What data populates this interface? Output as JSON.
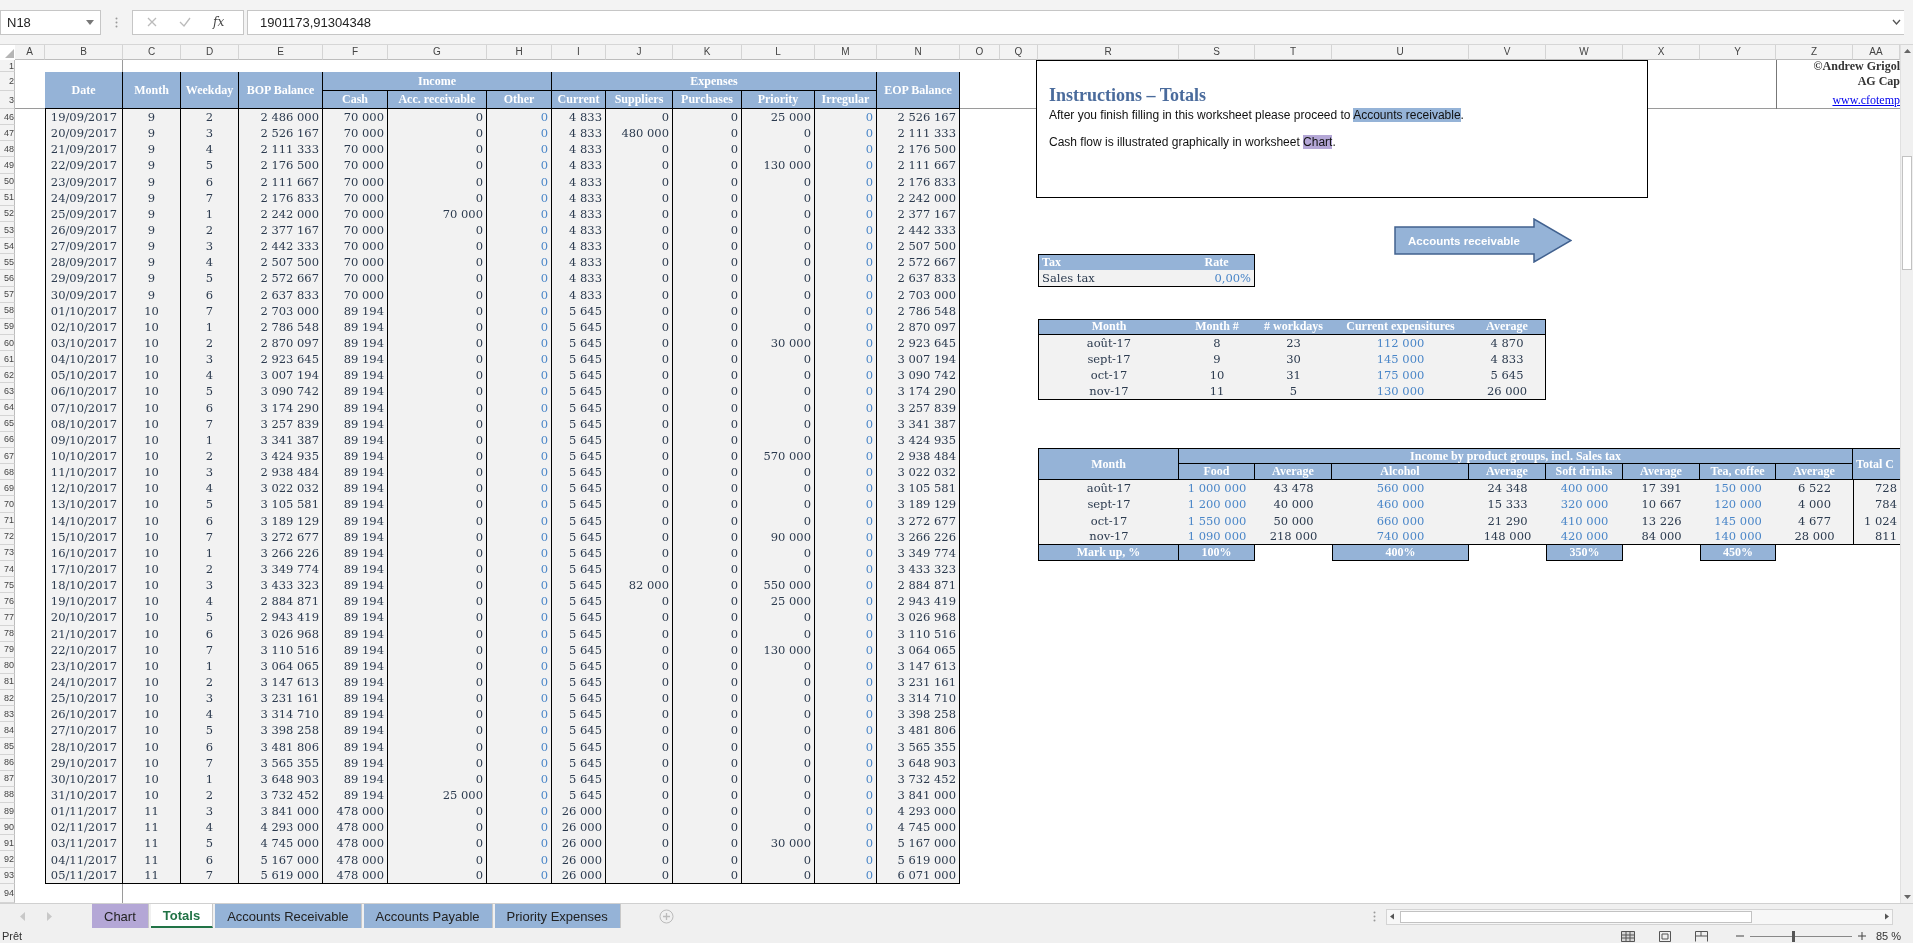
{
  "formula_bar": {
    "name_box": "N18",
    "function_label": "fx",
    "value": "1901173,91304348"
  },
  "column_letters": [
    "A",
    "B",
    "C",
    "D",
    "E",
    "F",
    "G",
    "H",
    "I",
    "J",
    "K",
    "L",
    "M",
    "N",
    "O",
    "Q",
    "R",
    "S",
    "T",
    "U",
    "V",
    "W",
    "X",
    "Y",
    "Z",
    "AA"
  ],
  "row_numbers": [
    "1",
    "2",
    "3",
    "46",
    "47",
    "48",
    "49",
    "50",
    "51",
    "52",
    "53",
    "54",
    "55",
    "56",
    "57",
    "58",
    "59",
    "60",
    "61",
    "62",
    "63",
    "64",
    "65",
    "66",
    "67",
    "68",
    "69",
    "70",
    "71",
    "72",
    "73",
    "74",
    "75",
    "76",
    "77",
    "78",
    "79",
    "80",
    "81",
    "82",
    "83",
    "84",
    "85",
    "86",
    "87",
    "88",
    "89",
    "90",
    "91",
    "92",
    "93",
    "94"
  ],
  "main_table": {
    "header": [
      {
        "label": "Date",
        "input": false
      },
      {
        "label": "Month",
        "input": false
      },
      {
        "label": "Weekday",
        "input": false
      },
      {
        "label": "BOP Balance",
        "input": false
      },
      {
        "label": "Income",
        "sub": [
          {
            "label": "Cash",
            "input": false
          },
          {
            "label": "Acc. receivable",
            "input": false
          },
          {
            "label": "Other",
            "input": true
          }
        ]
      },
      {
        "label": "Expenses",
        "sub": [
          {
            "label": "Current",
            "input": false
          },
          {
            "label": "Suppliers",
            "input": false
          },
          {
            "label": "Purchases",
            "input": false
          },
          {
            "label": "Priority",
            "input": false
          },
          {
            "label": "Irregular",
            "input": true
          }
        ]
      },
      {
        "label": "EOP Balance",
        "input": false
      }
    ],
    "rows": [
      [
        "19/09/2017",
        "9",
        "2",
        "2 486 000",
        "70 000",
        "0",
        "0",
        "4 833",
        "0",
        "0",
        "25 000",
        "0",
        "2 526 167"
      ],
      [
        "20/09/2017",
        "9",
        "3",
        "2 526 167",
        "70 000",
        "0",
        "0",
        "4 833",
        "480 000",
        "0",
        "0",
        "0",
        "2 111 333"
      ],
      [
        "21/09/2017",
        "9",
        "4",
        "2 111 333",
        "70 000",
        "0",
        "0",
        "4 833",
        "0",
        "0",
        "0",
        "0",
        "2 176 500"
      ],
      [
        "22/09/2017",
        "9",
        "5",
        "2 176 500",
        "70 000",
        "0",
        "0",
        "4 833",
        "0",
        "0",
        "130 000",
        "0",
        "2 111 667"
      ],
      [
        "23/09/2017",
        "9",
        "6",
        "2 111 667",
        "70 000",
        "0",
        "0",
        "4 833",
        "0",
        "0",
        "0",
        "0",
        "2 176 833"
      ],
      [
        "24/09/2017",
        "9",
        "7",
        "2 176 833",
        "70 000",
        "0",
        "0",
        "4 833",
        "0",
        "0",
        "0",
        "0",
        "2 242 000"
      ],
      [
        "25/09/2017",
        "9",
        "1",
        "2 242 000",
        "70 000",
        "70 000",
        "0",
        "4 833",
        "0",
        "0",
        "0",
        "0",
        "2 377 167"
      ],
      [
        "26/09/2017",
        "9",
        "2",
        "2 377 167",
        "70 000",
        "0",
        "0",
        "4 833",
        "0",
        "0",
        "0",
        "0",
        "2 442 333"
      ],
      [
        "27/09/2017",
        "9",
        "3",
        "2 442 333",
        "70 000",
        "0",
        "0",
        "4 833",
        "0",
        "0",
        "0",
        "0",
        "2 507 500"
      ],
      [
        "28/09/2017",
        "9",
        "4",
        "2 507 500",
        "70 000",
        "0",
        "0",
        "4 833",
        "0",
        "0",
        "0",
        "0",
        "2 572 667"
      ],
      [
        "29/09/2017",
        "9",
        "5",
        "2 572 667",
        "70 000",
        "0",
        "0",
        "4 833",
        "0",
        "0",
        "0",
        "0",
        "2 637 833"
      ],
      [
        "30/09/2017",
        "9",
        "6",
        "2 637 833",
        "70 000",
        "0",
        "0",
        "4 833",
        "0",
        "0",
        "0",
        "0",
        "2 703 000"
      ],
      [
        "01/10/2017",
        "10",
        "7",
        "2 703 000",
        "89 194",
        "0",
        "0",
        "5 645",
        "0",
        "0",
        "0",
        "0",
        "2 786 548"
      ],
      [
        "02/10/2017",
        "10",
        "1",
        "2 786 548",
        "89 194",
        "0",
        "0",
        "5 645",
        "0",
        "0",
        "0",
        "0",
        "2 870 097"
      ],
      [
        "03/10/2017",
        "10",
        "2",
        "2 870 097",
        "89 194",
        "0",
        "0",
        "5 645",
        "0",
        "0",
        "30 000",
        "0",
        "2 923 645"
      ],
      [
        "04/10/2017",
        "10",
        "3",
        "2 923 645",
        "89 194",
        "0",
        "0",
        "5 645",
        "0",
        "0",
        "0",
        "0",
        "3 007 194"
      ],
      [
        "05/10/2017",
        "10",
        "4",
        "3 007 194",
        "89 194",
        "0",
        "0",
        "5 645",
        "0",
        "0",
        "0",
        "0",
        "3 090 742"
      ],
      [
        "06/10/2017",
        "10",
        "5",
        "3 090 742",
        "89 194",
        "0",
        "0",
        "5 645",
        "0",
        "0",
        "0",
        "0",
        "3 174 290"
      ],
      [
        "07/10/2017",
        "10",
        "6",
        "3 174 290",
        "89 194",
        "0",
        "0",
        "5 645",
        "0",
        "0",
        "0",
        "0",
        "3 257 839"
      ],
      [
        "08/10/2017",
        "10",
        "7",
        "3 257 839",
        "89 194",
        "0",
        "0",
        "5 645",
        "0",
        "0",
        "0",
        "0",
        "3 341 387"
      ],
      [
        "09/10/2017",
        "10",
        "1",
        "3 341 387",
        "89 194",
        "0",
        "0",
        "5 645",
        "0",
        "0",
        "0",
        "0",
        "3 424 935"
      ],
      [
        "10/10/2017",
        "10",
        "2",
        "3 424 935",
        "89 194",
        "0",
        "0",
        "5 645",
        "0",
        "0",
        "570 000",
        "0",
        "2 938 484"
      ],
      [
        "11/10/2017",
        "10",
        "3",
        "2 938 484",
        "89 194",
        "0",
        "0",
        "5 645",
        "0",
        "0",
        "0",
        "0",
        "3 022 032"
      ],
      [
        "12/10/2017",
        "10",
        "4",
        "3 022 032",
        "89 194",
        "0",
        "0",
        "5 645",
        "0",
        "0",
        "0",
        "0",
        "3 105 581"
      ],
      [
        "13/10/2017",
        "10",
        "5",
        "3 105 581",
        "89 194",
        "0",
        "0",
        "5 645",
        "0",
        "0",
        "0",
        "0",
        "3 189 129"
      ],
      [
        "14/10/2017",
        "10",
        "6",
        "3 189 129",
        "89 194",
        "0",
        "0",
        "5 645",
        "0",
        "0",
        "0",
        "0",
        "3 272 677"
      ],
      [
        "15/10/2017",
        "10",
        "7",
        "3 272 677",
        "89 194",
        "0",
        "0",
        "5 645",
        "0",
        "0",
        "90 000",
        "0",
        "3 266 226"
      ],
      [
        "16/10/2017",
        "10",
        "1",
        "3 266 226",
        "89 194",
        "0",
        "0",
        "5 645",
        "0",
        "0",
        "0",
        "0",
        "3 349 774"
      ],
      [
        "17/10/2017",
        "10",
        "2",
        "3 349 774",
        "89 194",
        "0",
        "0",
        "5 645",
        "0",
        "0",
        "0",
        "0",
        "3 433 323"
      ],
      [
        "18/10/2017",
        "10",
        "3",
        "3 433 323",
        "89 194",
        "0",
        "0",
        "5 645",
        "82 000",
        "0",
        "550 000",
        "0",
        "2 884 871"
      ],
      [
        "19/10/2017",
        "10",
        "4",
        "2 884 871",
        "89 194",
        "0",
        "0",
        "5 645",
        "0",
        "0",
        "25 000",
        "0",
        "2 943 419"
      ],
      [
        "20/10/2017",
        "10",
        "5",
        "2 943 419",
        "89 194",
        "0",
        "0",
        "5 645",
        "0",
        "0",
        "0",
        "0",
        "3 026 968"
      ],
      [
        "21/10/2017",
        "10",
        "6",
        "3 026 968",
        "89 194",
        "0",
        "0",
        "5 645",
        "0",
        "0",
        "0",
        "0",
        "3 110 516"
      ],
      [
        "22/10/2017",
        "10",
        "7",
        "3 110 516",
        "89 194",
        "0",
        "0",
        "5 645",
        "0",
        "0",
        "130 000",
        "0",
        "3 064 065"
      ],
      [
        "23/10/2017",
        "10",
        "1",
        "3 064 065",
        "89 194",
        "0",
        "0",
        "5 645",
        "0",
        "0",
        "0",
        "0",
        "3 147 613"
      ],
      [
        "24/10/2017",
        "10",
        "2",
        "3 147 613",
        "89 194",
        "0",
        "0",
        "5 645",
        "0",
        "0",
        "0",
        "0",
        "3 231 161"
      ],
      [
        "25/10/2017",
        "10",
        "3",
        "3 231 161",
        "89 194",
        "0",
        "0",
        "5 645",
        "0",
        "0",
        "0",
        "0",
        "3 314 710"
      ],
      [
        "26/10/2017",
        "10",
        "4",
        "3 314 710",
        "89 194",
        "0",
        "0",
        "5 645",
        "0",
        "0",
        "0",
        "0",
        "3 398 258"
      ],
      [
        "27/10/2017",
        "10",
        "5",
        "3 398 258",
        "89 194",
        "0",
        "0",
        "5 645",
        "0",
        "0",
        "0",
        "0",
        "3 481 806"
      ],
      [
        "28/10/2017",
        "10",
        "6",
        "3 481 806",
        "89 194",
        "0",
        "0",
        "5 645",
        "0",
        "0",
        "0",
        "0",
        "3 565 355"
      ],
      [
        "29/10/2017",
        "10",
        "7",
        "3 565 355",
        "89 194",
        "0",
        "0",
        "5 645",
        "0",
        "0",
        "0",
        "0",
        "3 648 903"
      ],
      [
        "30/10/2017",
        "10",
        "1",
        "3 648 903",
        "89 194",
        "0",
        "0",
        "5 645",
        "0",
        "0",
        "0",
        "0",
        "3 732 452"
      ],
      [
        "31/10/2017",
        "10",
        "2",
        "3 732 452",
        "89 194",
        "25 000",
        "0",
        "5 645",
        "0",
        "0",
        "0",
        "0",
        "3 841 000"
      ],
      [
        "01/11/2017",
        "11",
        "3",
        "3 841 000",
        "478 000",
        "0",
        "0",
        "26 000",
        "0",
        "0",
        "0",
        "0",
        "4 293 000"
      ],
      [
        "02/11/2017",
        "11",
        "4",
        "4 293 000",
        "478 000",
        "0",
        "0",
        "26 000",
        "0",
        "0",
        "0",
        "0",
        "4 745 000"
      ],
      [
        "03/11/2017",
        "11",
        "5",
        "4 745 000",
        "478 000",
        "0",
        "0",
        "26 000",
        "0",
        "0",
        "30 000",
        "0",
        "5 167 000"
      ],
      [
        "04/11/2017",
        "11",
        "6",
        "5 167 000",
        "478 000",
        "0",
        "0",
        "26 000",
        "0",
        "0",
        "0",
        "0",
        "5 619 000"
      ],
      [
        "05/11/2017",
        "11",
        "7",
        "5 619 000",
        "478 000",
        "0",
        "0",
        "26 000",
        "0",
        "0",
        "0",
        "0",
        "6 071 000"
      ]
    ]
  },
  "instructions": {
    "title": "Instructions – Totals",
    "paragraphs": [
      {
        "text": "After you finish filling in this worksheet please proceed to ",
        "link": "Accounts receivable",
        "end": ".",
        "color": "#95b3d7"
      },
      {
        "text": "Cash flow is illustrated graphically in worksheet ",
        "link": "Chart",
        "end": ".",
        "color": "#b4a7d6"
      }
    ]
  },
  "credits": {
    "lines": [
      "©Andrew Grigol",
      "AG Cap"
    ],
    "link": "www.cfotemp"
  },
  "next_button": {
    "label": "Accounts receivable"
  },
  "tax_table": {
    "columns": [
      {
        "label": "Tax",
        "input": false
      },
      {
        "label": "Rate",
        "input": true
      }
    ],
    "rows": [
      [
        "Sales tax",
        "0,00%"
      ]
    ]
  },
  "month_table": {
    "columns": [
      {
        "label": "Month",
        "input": false
      },
      {
        "label": "Month #",
        "input": false
      },
      {
        "label": "# workdays",
        "input": false
      },
      {
        "label": "Current expensitures",
        "input": true
      },
      {
        "label": "Average",
        "input": false
      }
    ],
    "rows": [
      [
        "août-17",
        "8",
        "23",
        "112 000",
        "4 870"
      ],
      [
        "sept-17",
        "9",
        "30",
        "145 000",
        "4 833"
      ],
      [
        "oct-17",
        "10",
        "31",
        "175 000",
        "5 645"
      ],
      [
        "nov-17",
        "11",
        "5",
        "130 000",
        "26 000"
      ]
    ]
  },
  "income_table": {
    "month_label": "Month",
    "group_label": "Income by product groups, incl. Sales tax",
    "total_label": "Total C",
    "columns": [
      {
        "label": "Food",
        "input": true
      },
      {
        "label": "Average",
        "input": false
      },
      {
        "label": "Alcohol",
        "input": true
      },
      {
        "label": "Average",
        "input": false
      },
      {
        "label": "Soft drinks",
        "input": true
      },
      {
        "label": "Average",
        "input": false
      },
      {
        "label": "Tea, coffee",
        "input": true
      },
      {
        "label": "Average",
        "input": false
      }
    ],
    "rows": [
      {
        "month": "août-17",
        "values": [
          "1 000 000",
          "43 478",
          "560 000",
          "24 348",
          "400 000",
          "17 391",
          "150 000",
          "6 522"
        ],
        "total": "728"
      },
      {
        "month": "sept-17",
        "values": [
          "1 200 000",
          "40 000",
          "460 000",
          "15 333",
          "320 000",
          "10 667",
          "120 000",
          "4 000"
        ],
        "total": "784"
      },
      {
        "month": "oct-17",
        "values": [
          "1 550 000",
          "50 000",
          "660 000",
          "21 290",
          "410 000",
          "13 226",
          "145 000",
          "4 677"
        ],
        "total": "1 024"
      },
      {
        "month": "nov-17",
        "values": [
          "1 090 000",
          "218 000",
          "740 000",
          "148 000",
          "420 000",
          "84 000",
          "140 000",
          "28 000"
        ],
        "total": "811"
      }
    ],
    "markup": {
      "label": "Mark up, %",
      "values": [
        "100%",
        "400%",
        "350%",
        "450%"
      ]
    }
  },
  "tabs": [
    {
      "label": "Chart",
      "color": "#b4a7d6",
      "selected": false
    },
    {
      "label": "Totals",
      "selected": true
    },
    {
      "label": "Accounts Receivable",
      "color": "#95b3d7",
      "selected": false
    },
    {
      "label": "Accounts Payable",
      "color": "#95b3d7",
      "selected": false
    },
    {
      "label": "Priority Expenses",
      "color": "#95b3d7",
      "selected": false
    }
  ],
  "status": "Prêt",
  "zoom": {
    "level": 0.41,
    "reading": "85 %"
  }
}
